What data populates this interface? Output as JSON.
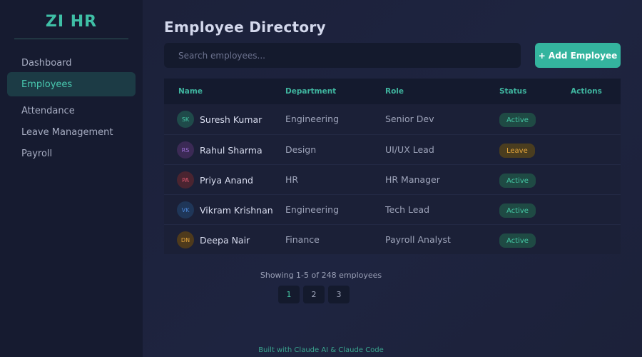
{
  "sidebar": {
    "logo": "ZI HR",
    "items": [
      {
        "label": "Dashboard",
        "active": false
      },
      {
        "label": "Employees",
        "active": true
      },
      {
        "label": "Attendance",
        "active": false
      },
      {
        "label": "Leave Management",
        "active": false
      },
      {
        "label": "Payroll",
        "active": false
      }
    ]
  },
  "main": {
    "title": "Employee Directory",
    "search_placeholder": "Search employees...",
    "add_button": "+ Add Employee",
    "columns": [
      "Name",
      "Department",
      "Role",
      "Status",
      "Actions"
    ],
    "employees": [
      {
        "initials": "SK",
        "name": "Suresh Kumar",
        "department": "Engineering",
        "role": "Senior Dev",
        "status": "Active",
        "avatar_bg": "#1f4a4a",
        "avatar_fg": "#45c9a6"
      },
      {
        "initials": "RS",
        "name": "Rahul Sharma",
        "department": "Design",
        "role": "UI/UX Lead",
        "status": "Leave",
        "avatar_bg": "#3b2a55",
        "avatar_fg": "#9b6fd6"
      },
      {
        "initials": "PA",
        "name": "Priya Anand",
        "department": "HR",
        "role": "HR Manager",
        "status": "Active",
        "avatar_bg": "#4a2430",
        "avatar_fg": "#e0566f"
      },
      {
        "initials": "VK",
        "name": "Vikram Krishnan",
        "department": "Engineering",
        "role": "Tech Lead",
        "status": "Active",
        "avatar_bg": "#1f3658",
        "avatar_fg": "#4a86d8"
      },
      {
        "initials": "DN",
        "name": "Deepa Nair",
        "department": "Finance",
        "role": "Payroll Analyst",
        "status": "Active",
        "avatar_bg": "#4e3a1c",
        "avatar_fg": "#e6a63b"
      }
    ],
    "pagination": {
      "info": "Showing 1-5 of 248 employees",
      "pages": [
        "1",
        "2",
        "3"
      ],
      "current": "1"
    }
  },
  "footer": "Built with Claude AI & Claude Code",
  "colors": {
    "accent": "#34b49e",
    "active_badge": "#45c9a6",
    "leave_badge": "#e6a63b"
  }
}
